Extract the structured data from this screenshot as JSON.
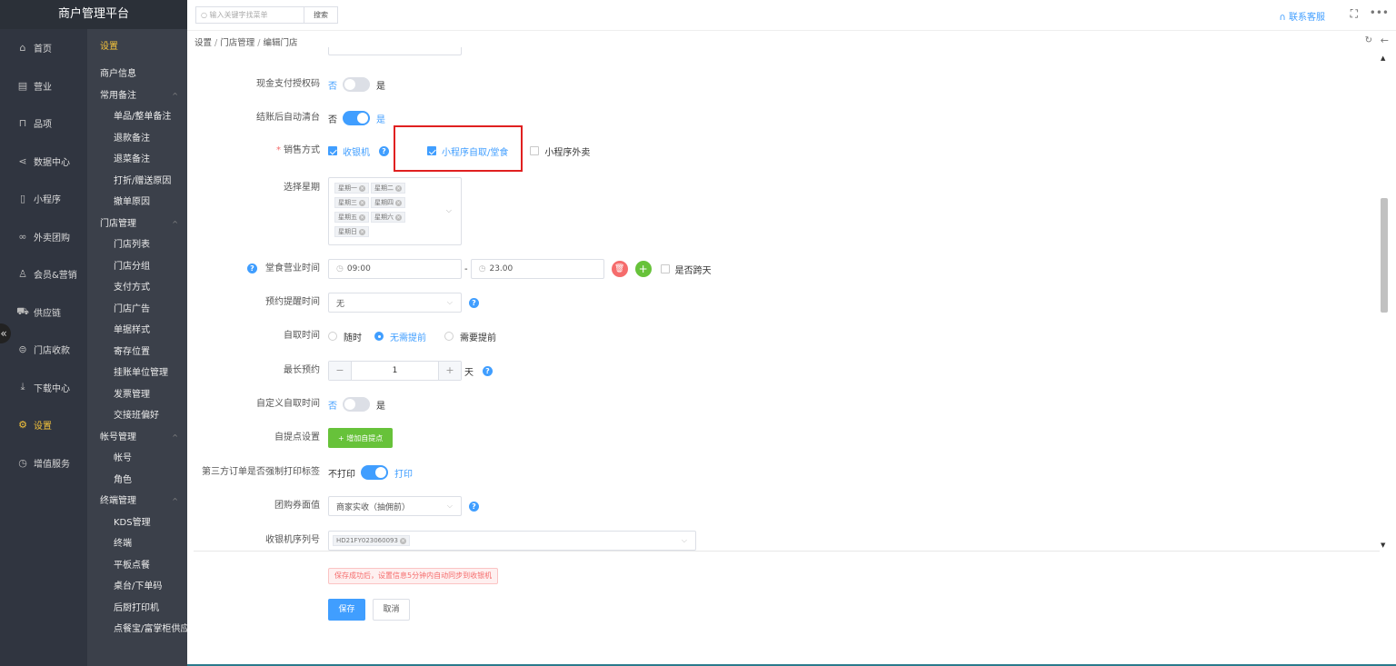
{
  "app": {
    "title": "商户管理平台"
  },
  "sidebar": {
    "items": [
      {
        "label": "首页",
        "icon": "home-icon",
        "glyph": "⌂"
      },
      {
        "label": "营业",
        "icon": "calendar-icon",
        "glyph": "▤"
      },
      {
        "label": "品项",
        "icon": "bag-icon",
        "glyph": "⊓"
      },
      {
        "label": "数据中心",
        "icon": "share-icon",
        "glyph": "⋖"
      },
      {
        "label": "小程序",
        "icon": "phone-icon",
        "glyph": "▯"
      },
      {
        "label": "外卖团购",
        "icon": "bike-icon",
        "glyph": "∞"
      },
      {
        "label": "会员&营销",
        "icon": "user-icon",
        "glyph": "♙"
      },
      {
        "label": "供应链",
        "icon": "truck-icon",
        "glyph": "⛟"
      },
      {
        "label": "门店收款",
        "icon": "coin-icon",
        "glyph": "⊜"
      },
      {
        "label": "下载中心",
        "icon": "download-icon",
        "glyph": "⤓"
      },
      {
        "label": "设置",
        "icon": "settings-icon",
        "glyph": "⚙"
      },
      {
        "label": "增值服务",
        "icon": "clock-icon",
        "glyph": "◷"
      }
    ],
    "active_index": 10,
    "collapse_glyph": "«"
  },
  "submenu": {
    "header": "设置",
    "groups": [
      {
        "label": "商户信息",
        "chev": "",
        "items": []
      },
      {
        "label": "常用备注",
        "chev": "^",
        "items": [
          "单品/整单备注",
          "退款备注",
          "退菜备注",
          "打折/赠送原因",
          "撤单原因"
        ]
      },
      {
        "label": "门店管理",
        "chev": "^",
        "items": [
          "门店列表",
          "门店分组",
          "支付方式",
          "门店广告",
          "单据样式",
          "寄存位置",
          "挂账单位管理",
          "发票管理",
          "交接班偏好"
        ]
      },
      {
        "label": "帐号管理",
        "chev": "^",
        "items": [
          "帐号",
          "角色"
        ]
      },
      {
        "label": "终端管理",
        "chev": "^",
        "items": [
          "KDS管理",
          "终端",
          "平板点餐",
          "桌台/下单码",
          "后厨打印机",
          "点餐宝/富掌柜供应"
        ]
      }
    ]
  },
  "topbar": {
    "search_placeholder": "输入关键字找菜单",
    "search_button": "搜索",
    "service": "联系客服",
    "fullscreen_glyph": "⛶",
    "more_glyph": "•••"
  },
  "breadcrumb": [
    "设置",
    "门店管理",
    "编辑门店"
  ],
  "form": {
    "cash_auth": {
      "label": "现金支付授权码",
      "off": "否",
      "on": "是",
      "value": false
    },
    "auto_clear": {
      "label": "结账后自动清台",
      "off": "否",
      "on": "是",
      "value": true
    },
    "sale_mode": {
      "label": "销售方式",
      "options": [
        {
          "label": "收银机",
          "checked": true
        },
        {
          "label": "小程序自取/堂食",
          "checked": true
        },
        {
          "label": "小程序外卖",
          "checked": false
        }
      ]
    },
    "weekdays": {
      "label": "选择星期",
      "tags": [
        "星期一",
        "星期二",
        "星期三",
        "星期四",
        "星期五",
        "星期六",
        "星期日"
      ]
    },
    "dine_hours": {
      "label": "堂食营业时间",
      "start": "09:00",
      "sep": "-",
      "end": "23.00",
      "cross_day": "是否跨天"
    },
    "reserve_remind": {
      "label": "预约提醒时间",
      "value": "无"
    },
    "pickup_time": {
      "label": "自取时间",
      "options": [
        "随时",
        "无需提前",
        "需要提前"
      ],
      "selected": 1
    },
    "max_reserve": {
      "label": "最长预约",
      "minus": "−",
      "value": "1",
      "plus": "+",
      "unit": "天"
    },
    "custom_pickup": {
      "label": "自定义自取时间",
      "off": "否",
      "on": "是",
      "value": false
    },
    "pickup_point": {
      "label": "自提点设置",
      "button": "+ 增加自提点"
    },
    "third_party_print": {
      "label": "第三方订单是否强制打印标签",
      "off": "不打印",
      "on": "打印",
      "value": true
    },
    "group_voucher": {
      "label": "团购券面值",
      "value": "商家实收（抽佣前）"
    },
    "pos_serial": {
      "label": "收银机序列号",
      "value": "HD21FY023060093"
    }
  },
  "footer": {
    "notice": "保存成功后，设置信息5分钟内自动同步到收银机",
    "save": "保存",
    "cancel": "取消"
  },
  "colors": {
    "accent": "#409eff",
    "active_nav": "#f5c33b",
    "highlight_box": "#e02020",
    "add_green": "#67c23a",
    "delete_red": "#f56c6c"
  }
}
